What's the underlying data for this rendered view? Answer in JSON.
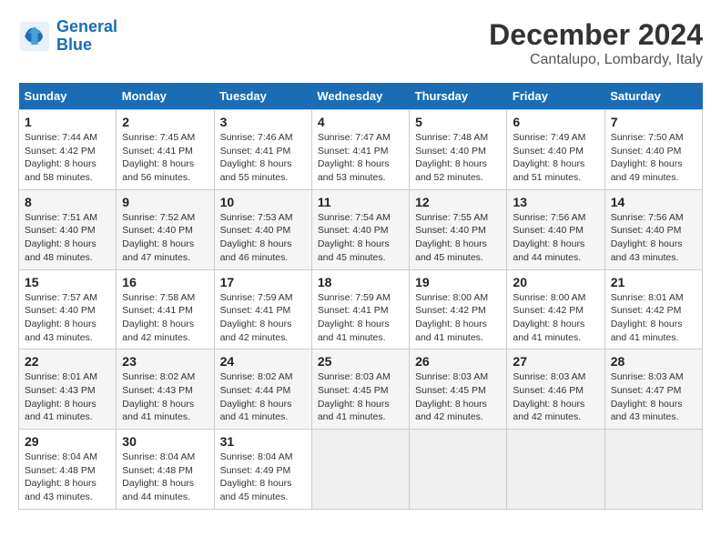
{
  "logo": {
    "text_general": "General",
    "text_blue": "Blue"
  },
  "title": "December 2024",
  "subtitle": "Cantalupo, Lombardy, Italy",
  "weekdays": [
    "Sunday",
    "Monday",
    "Tuesday",
    "Wednesday",
    "Thursday",
    "Friday",
    "Saturday"
  ],
  "weeks": [
    [
      {
        "day": "1",
        "sunrise": "Sunrise: 7:44 AM",
        "sunset": "Sunset: 4:42 PM",
        "daylight": "Daylight: 8 hours and 58 minutes."
      },
      {
        "day": "2",
        "sunrise": "Sunrise: 7:45 AM",
        "sunset": "Sunset: 4:41 PM",
        "daylight": "Daylight: 8 hours and 56 minutes."
      },
      {
        "day": "3",
        "sunrise": "Sunrise: 7:46 AM",
        "sunset": "Sunset: 4:41 PM",
        "daylight": "Daylight: 8 hours and 55 minutes."
      },
      {
        "day": "4",
        "sunrise": "Sunrise: 7:47 AM",
        "sunset": "Sunset: 4:41 PM",
        "daylight": "Daylight: 8 hours and 53 minutes."
      },
      {
        "day": "5",
        "sunrise": "Sunrise: 7:48 AM",
        "sunset": "Sunset: 4:40 PM",
        "daylight": "Daylight: 8 hours and 52 minutes."
      },
      {
        "day": "6",
        "sunrise": "Sunrise: 7:49 AM",
        "sunset": "Sunset: 4:40 PM",
        "daylight": "Daylight: 8 hours and 51 minutes."
      },
      {
        "day": "7",
        "sunrise": "Sunrise: 7:50 AM",
        "sunset": "Sunset: 4:40 PM",
        "daylight": "Daylight: 8 hours and 49 minutes."
      }
    ],
    [
      {
        "day": "8",
        "sunrise": "Sunrise: 7:51 AM",
        "sunset": "Sunset: 4:40 PM",
        "daylight": "Daylight: 8 hours and 48 minutes."
      },
      {
        "day": "9",
        "sunrise": "Sunrise: 7:52 AM",
        "sunset": "Sunset: 4:40 PM",
        "daylight": "Daylight: 8 hours and 47 minutes."
      },
      {
        "day": "10",
        "sunrise": "Sunrise: 7:53 AM",
        "sunset": "Sunset: 4:40 PM",
        "daylight": "Daylight: 8 hours and 46 minutes."
      },
      {
        "day": "11",
        "sunrise": "Sunrise: 7:54 AM",
        "sunset": "Sunset: 4:40 PM",
        "daylight": "Daylight: 8 hours and 45 minutes."
      },
      {
        "day": "12",
        "sunrise": "Sunrise: 7:55 AM",
        "sunset": "Sunset: 4:40 PM",
        "daylight": "Daylight: 8 hours and 45 minutes."
      },
      {
        "day": "13",
        "sunrise": "Sunrise: 7:56 AM",
        "sunset": "Sunset: 4:40 PM",
        "daylight": "Daylight: 8 hours and 44 minutes."
      },
      {
        "day": "14",
        "sunrise": "Sunrise: 7:56 AM",
        "sunset": "Sunset: 4:40 PM",
        "daylight": "Daylight: 8 hours and 43 minutes."
      }
    ],
    [
      {
        "day": "15",
        "sunrise": "Sunrise: 7:57 AM",
        "sunset": "Sunset: 4:40 PM",
        "daylight": "Daylight: 8 hours and 43 minutes."
      },
      {
        "day": "16",
        "sunrise": "Sunrise: 7:58 AM",
        "sunset": "Sunset: 4:41 PM",
        "daylight": "Daylight: 8 hours and 42 minutes."
      },
      {
        "day": "17",
        "sunrise": "Sunrise: 7:59 AM",
        "sunset": "Sunset: 4:41 PM",
        "daylight": "Daylight: 8 hours and 42 minutes."
      },
      {
        "day": "18",
        "sunrise": "Sunrise: 7:59 AM",
        "sunset": "Sunset: 4:41 PM",
        "daylight": "Daylight: 8 hours and 41 minutes."
      },
      {
        "day": "19",
        "sunrise": "Sunrise: 8:00 AM",
        "sunset": "Sunset: 4:42 PM",
        "daylight": "Daylight: 8 hours and 41 minutes."
      },
      {
        "day": "20",
        "sunrise": "Sunrise: 8:00 AM",
        "sunset": "Sunset: 4:42 PM",
        "daylight": "Daylight: 8 hours and 41 minutes."
      },
      {
        "day": "21",
        "sunrise": "Sunrise: 8:01 AM",
        "sunset": "Sunset: 4:42 PM",
        "daylight": "Daylight: 8 hours and 41 minutes."
      }
    ],
    [
      {
        "day": "22",
        "sunrise": "Sunrise: 8:01 AM",
        "sunset": "Sunset: 4:43 PM",
        "daylight": "Daylight: 8 hours and 41 minutes."
      },
      {
        "day": "23",
        "sunrise": "Sunrise: 8:02 AM",
        "sunset": "Sunset: 4:43 PM",
        "daylight": "Daylight: 8 hours and 41 minutes."
      },
      {
        "day": "24",
        "sunrise": "Sunrise: 8:02 AM",
        "sunset": "Sunset: 4:44 PM",
        "daylight": "Daylight: 8 hours and 41 minutes."
      },
      {
        "day": "25",
        "sunrise": "Sunrise: 8:03 AM",
        "sunset": "Sunset: 4:45 PM",
        "daylight": "Daylight: 8 hours and 41 minutes."
      },
      {
        "day": "26",
        "sunrise": "Sunrise: 8:03 AM",
        "sunset": "Sunset: 4:45 PM",
        "daylight": "Daylight: 8 hours and 42 minutes."
      },
      {
        "day": "27",
        "sunrise": "Sunrise: 8:03 AM",
        "sunset": "Sunset: 4:46 PM",
        "daylight": "Daylight: 8 hours and 42 minutes."
      },
      {
        "day": "28",
        "sunrise": "Sunrise: 8:03 AM",
        "sunset": "Sunset: 4:47 PM",
        "daylight": "Daylight: 8 hours and 43 minutes."
      }
    ],
    [
      {
        "day": "29",
        "sunrise": "Sunrise: 8:04 AM",
        "sunset": "Sunset: 4:48 PM",
        "daylight": "Daylight: 8 hours and 43 minutes."
      },
      {
        "day": "30",
        "sunrise": "Sunrise: 8:04 AM",
        "sunset": "Sunset: 4:48 PM",
        "daylight": "Daylight: 8 hours and 44 minutes."
      },
      {
        "day": "31",
        "sunrise": "Sunrise: 8:04 AM",
        "sunset": "Sunset: 4:49 PM",
        "daylight": "Daylight: 8 hours and 45 minutes."
      },
      null,
      null,
      null,
      null
    ]
  ]
}
